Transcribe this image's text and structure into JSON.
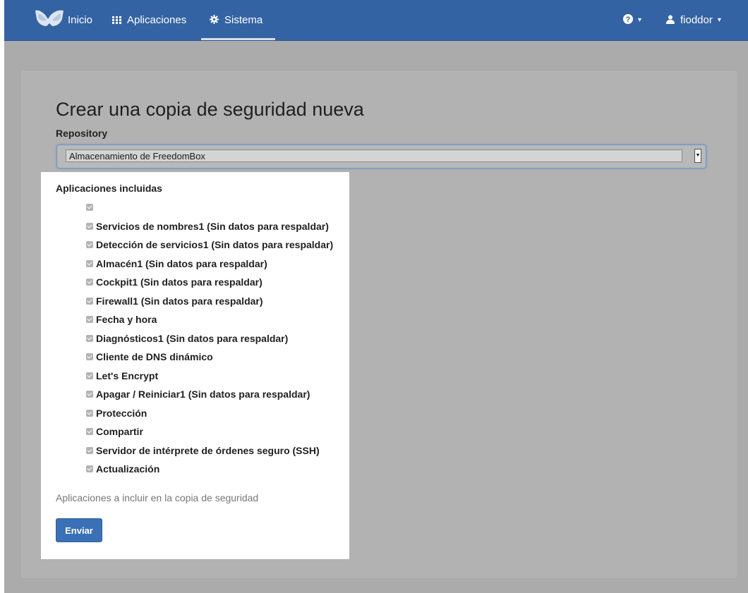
{
  "navbar": {
    "home_label": "Inicio",
    "apps_label": "Aplicaciones",
    "system_label": "Sistema",
    "help_caret": "▾",
    "user_label": "fioddor",
    "user_caret": "▾"
  },
  "form": {
    "title": "Crear una copia de seguridad nueva",
    "repository_label": "Repository",
    "repository_value": "Almacenamiento de FreedomBox",
    "apps_label": "Aplicaciones incluidas",
    "apps": [
      "",
      "Servicios de nombres1 (Sin datos para respaldar)",
      "Detección de servicios1 (Sin datos para respaldar)",
      "Almacén1 (Sin datos para respaldar)",
      "Cockpit1 (Sin datos para respaldar)",
      "Firewall1 (Sin datos para respaldar)",
      "Fecha y hora",
      "Diagnósticos1 (Sin datos para respaldar)",
      "Cliente de DNS dinámico",
      "Let's Encrypt",
      "Apagar / Reiniciar1 (Sin datos para respaldar)",
      "Protección",
      "Compartir",
      "Servidor de intérprete de órdenes seguro (SSH)",
      "Actualización"
    ],
    "help_text": "Aplicaciones a incluir en la copia de seguridad",
    "submit_label": "Enviar"
  },
  "colors": {
    "navbar": "#3463a3",
    "primary_button": "#3a70b5",
    "overlay_background": "#ababab"
  }
}
